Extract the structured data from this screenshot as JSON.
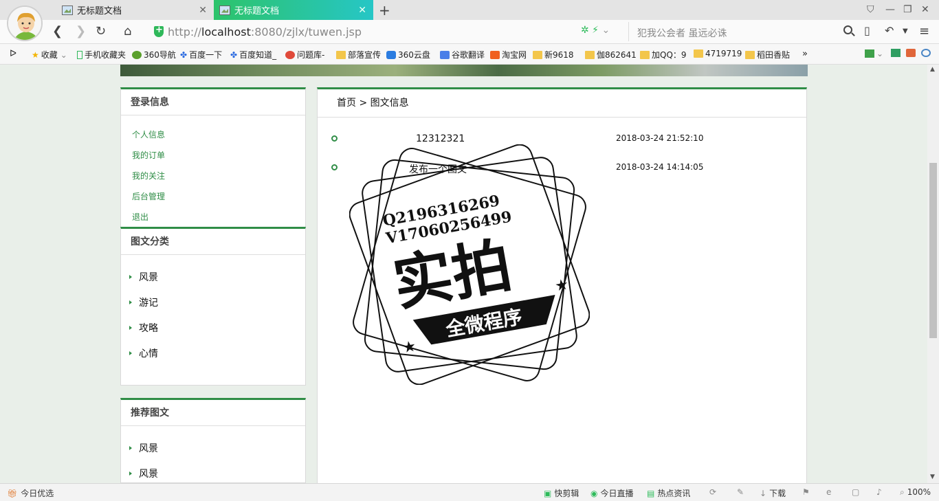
{
  "browser": {
    "tabs": [
      {
        "title": "无标题文档",
        "active": false
      },
      {
        "title": "无标题文档",
        "active": true
      }
    ],
    "url_prefix": "http://",
    "url_host": "localhost",
    "url_rest": ":8080/zjlx/tuwen.jsp",
    "search_placeholder": "犯我公会者 虽远必诛",
    "bookmarks": [
      "收藏",
      "手机收藏夹",
      "360导航",
      "百度一下",
      "百度知道_",
      "问题库-",
      "部落宣传",
      "360云盘",
      "谷歌翻译",
      "淘宝网",
      "新9618",
      "伽862641",
      "加QQ：9",
      "4719719",
      "稻田香贴"
    ],
    "accent_color": "#2dc36a"
  },
  "sidebar": {
    "login": {
      "title": "登录信息",
      "links": [
        "个人信息",
        "我的订单",
        "我的关注",
        "后台管理",
        "退出"
      ]
    },
    "categories": {
      "title": "图文分类",
      "items": [
        "风景",
        "游记",
        "攻略",
        "心情"
      ]
    },
    "recommended": {
      "title": "推荐图文",
      "items": [
        "风景",
        "风景"
      ]
    }
  },
  "main": {
    "breadcrumb": "首页 > 图文信息",
    "articles": [
      {
        "title": "12312321",
        "date": "2018-03-24 21:52:10"
      },
      {
        "title": "发布一个图文",
        "date": "2018-03-24 14:14:05"
      }
    ]
  },
  "stamp": {
    "line1": "Q2196316269",
    "line2": "V17060256499",
    "big": "实拍",
    "ribbon": "全微程序"
  },
  "statusbar": {
    "left": "今日优选",
    "items": [
      "快剪辑",
      "今日直播",
      "热点资讯",
      "下载",
      "100%"
    ]
  },
  "theme_green": "#2f8d46"
}
